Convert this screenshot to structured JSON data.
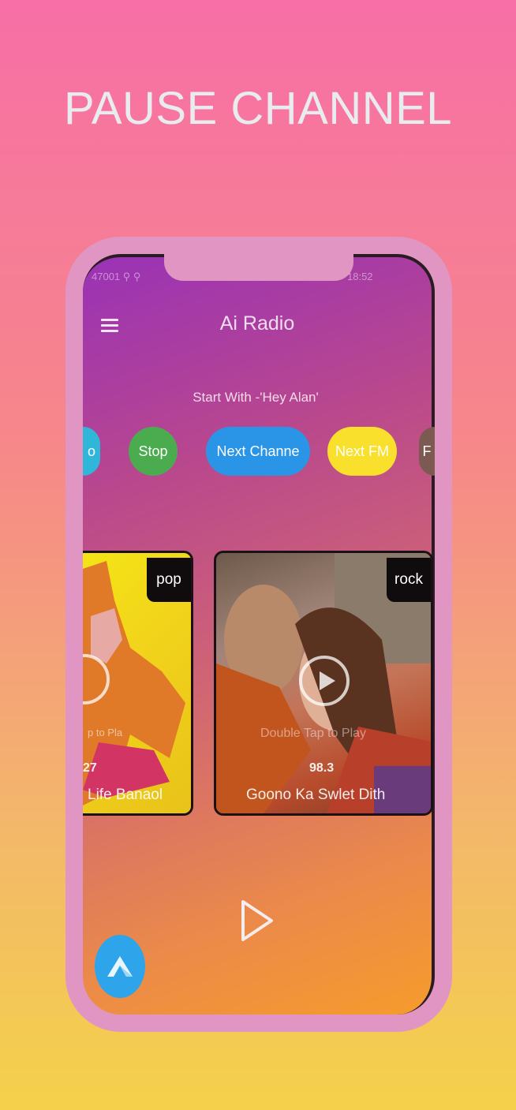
{
  "promo": {
    "headline": "PAUSE CHANNEL"
  },
  "status_bar": {
    "left": "47001 ⚲ ⚲",
    "right": "18:52"
  },
  "app": {
    "title": "Ai Radio",
    "hint": "Start With -'Hey Alan'",
    "chips": [
      {
        "label": "o",
        "color": "#2fb6d9"
      },
      {
        "label": "Stop",
        "color": "#4bac4f"
      },
      {
        "label": "Next Channe",
        "color": "#2a95e6"
      },
      {
        "label": "Next FM",
        "color": "#f8e02d"
      },
      {
        "label": "F",
        "color": "#7c5a52"
      }
    ],
    "stations": [
      {
        "genre": "pop",
        "tap_hint": "p to Pla",
        "frequency": "27",
        "name": "Life Banaol"
      },
      {
        "genre": "rock",
        "tap_hint": "Double Tap to Play",
        "frequency": "98.3",
        "name": "Goono Ka Swlet Dith"
      }
    ]
  },
  "icons": {
    "menu": "hamburger-menu-icon",
    "play": "play-icon",
    "assistant": "alan-assistant-icon"
  },
  "colors": {
    "background_top": "#f76fa6",
    "background_bottom": "#f4d14a",
    "phone_frame": "#e195c3",
    "headline": "#e9ecef"
  }
}
